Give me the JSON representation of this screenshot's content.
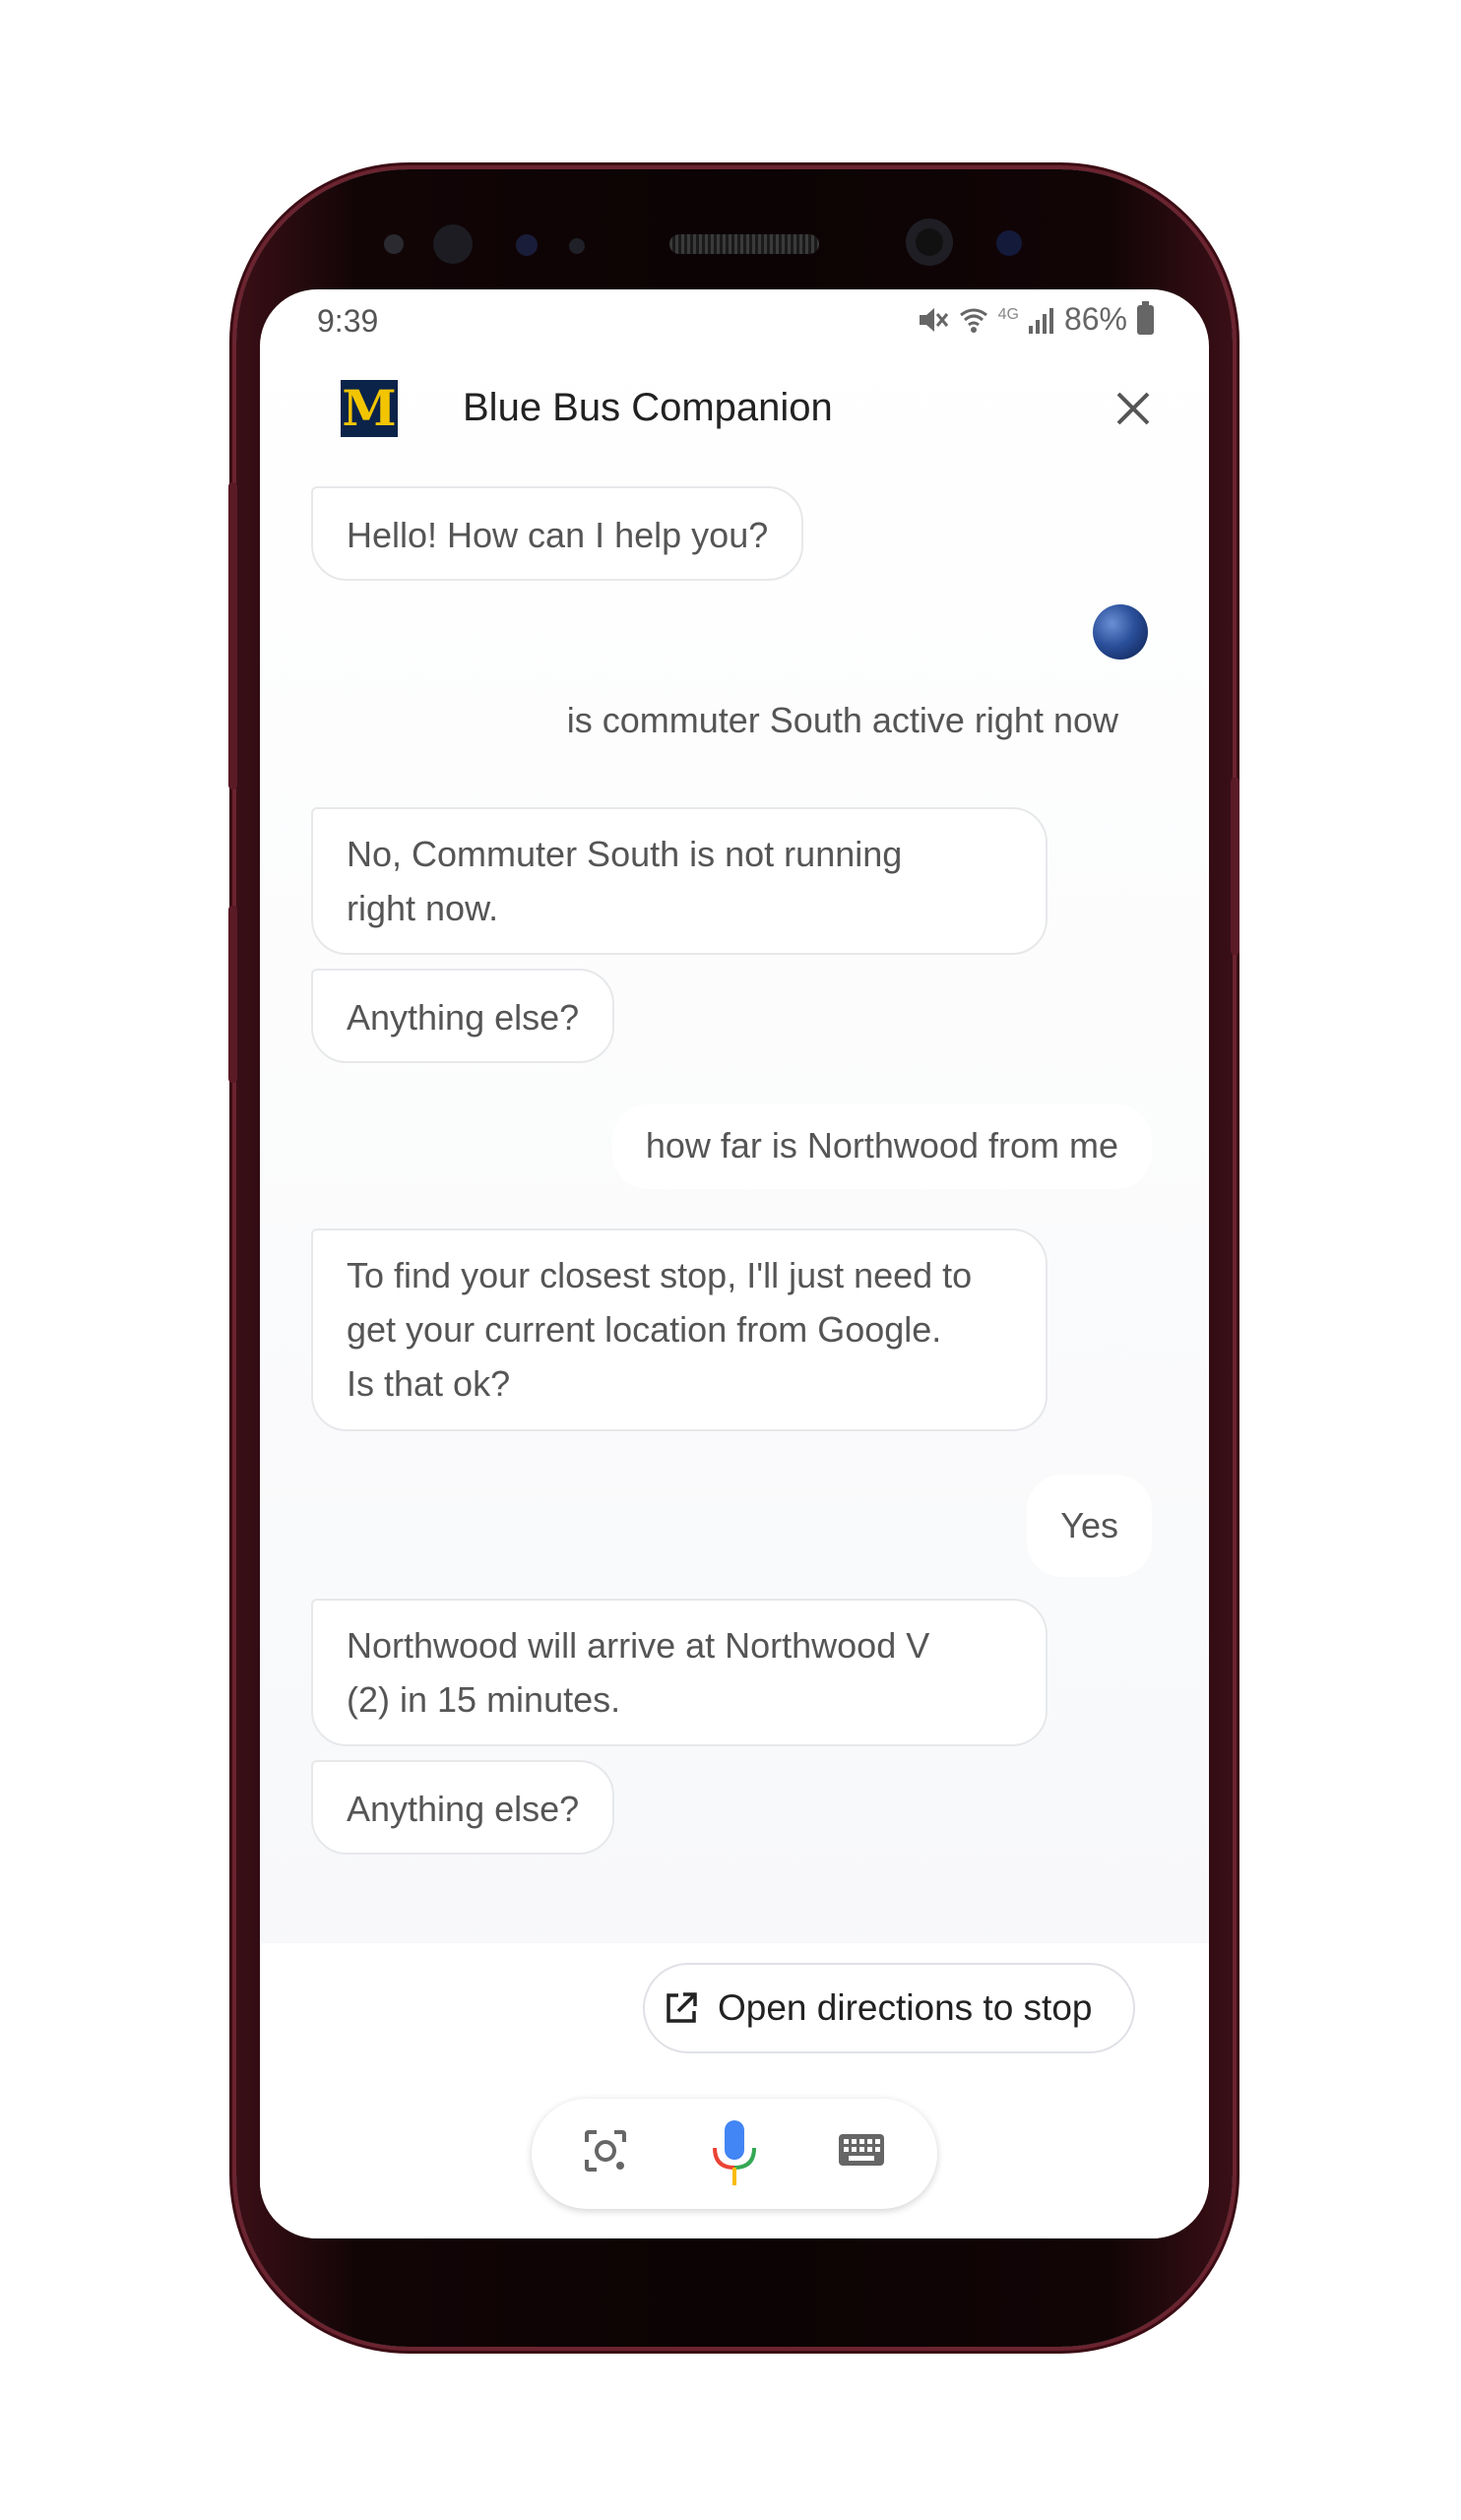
{
  "status": {
    "time": "9:39",
    "battery": "86%"
  },
  "header": {
    "title": "Blue Bus Companion",
    "logo_letter": "M"
  },
  "messages": [
    {
      "from": "bot",
      "text": "Hello! How can I help you?"
    },
    {
      "from": "user",
      "text": "is commuter South active right now"
    },
    {
      "from": "bot",
      "lines": [
        "No, Commuter South is not running",
        "right now."
      ]
    },
    {
      "from": "bot",
      "text": "Anything else?"
    },
    {
      "from": "user",
      "text": "how far is Northwood from me"
    },
    {
      "from": "bot",
      "lines": [
        "To find your closest stop, I'll just need to",
        "get your current location from Google.",
        "Is that ok?"
      ]
    },
    {
      "from": "user",
      "text": "Yes"
    },
    {
      "from": "bot",
      "lines": [
        "Northwood will arrive at Northwood V",
        "(2) in 15 minutes."
      ]
    },
    {
      "from": "bot",
      "text": "Anything else?"
    }
  ],
  "suggestion": {
    "label": "Open directions to stop"
  },
  "icons": {
    "close": "close-icon",
    "lens": "lens-icon",
    "mic": "microphone-icon",
    "keyboard": "keyboard-icon",
    "open_external": "open-external-icon"
  },
  "colors": {
    "logo_bg": "#0b2349",
    "logo_fg": "#f2c500",
    "mic_blue": "#4285f4",
    "mic_red": "#ea4335",
    "mic_yellow": "#fbbc05",
    "mic_green": "#34a853"
  }
}
